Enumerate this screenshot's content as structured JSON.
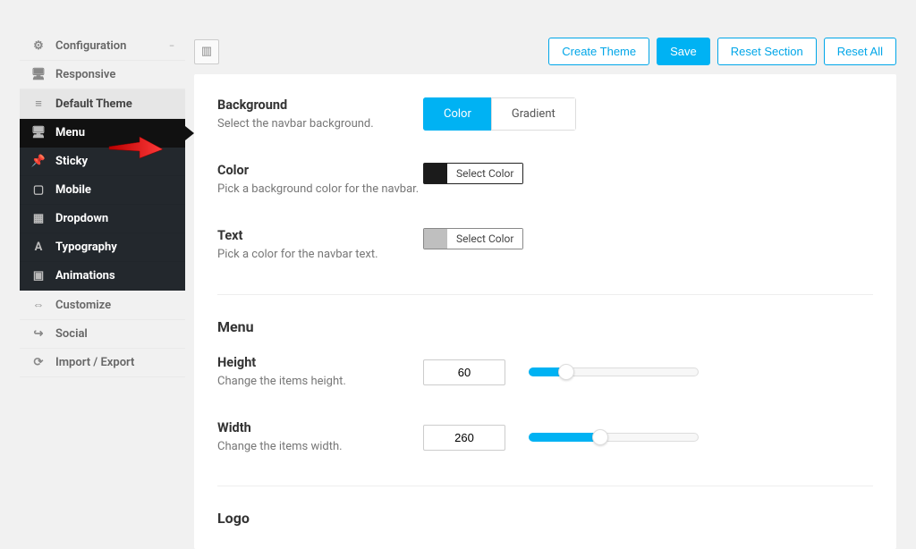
{
  "sidebar": {
    "configuration": "Configuration",
    "responsive": "Responsive",
    "default_theme": "Default Theme",
    "menu": "Menu",
    "sticky": "Sticky",
    "mobile": "Mobile",
    "dropdown": "Dropdown",
    "typography": "Typography",
    "animations": "Animations",
    "customize": "Customize",
    "social": "Social",
    "import_export": "Import / Export"
  },
  "topbar": {
    "create_theme": "Create Theme",
    "save": "Save",
    "reset_section": "Reset Section",
    "reset_all": "Reset All"
  },
  "background": {
    "title": "Background",
    "desc": "Select the navbar background.",
    "opt_color": "Color",
    "opt_gradient": "Gradient"
  },
  "color": {
    "title": "Color",
    "desc": "Pick a background color for the navbar.",
    "btn": "Select Color",
    "swatch": "#1b1b1b"
  },
  "text": {
    "title": "Text",
    "desc": "Pick a color for the navbar text.",
    "btn": "Select Color",
    "swatch": "#bfbfbf"
  },
  "menu_section": {
    "title": "Menu",
    "height_title": "Height",
    "height_desc": "Change the items height.",
    "height_value": "60",
    "height_fill_pct": 22,
    "width_title": "Width",
    "width_desc": "Change the items width.",
    "width_value": "260",
    "width_fill_pct": 42
  },
  "logo_section": {
    "title": "Logo"
  }
}
